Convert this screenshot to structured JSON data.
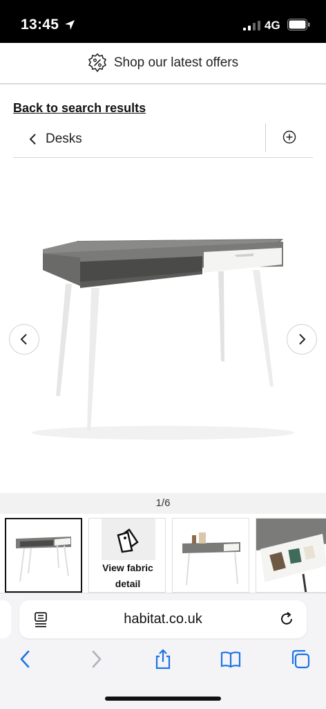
{
  "status_bar": {
    "time": "13:45",
    "network": "4G"
  },
  "offers": {
    "label": "Shop our latest offers"
  },
  "back_link": "Back to search results",
  "breadcrumb": {
    "label": "Desks"
  },
  "gallery": {
    "counter": "1/6"
  },
  "thumbnails": {
    "fabric_label": "View fabric detail"
  },
  "browser": {
    "url": "habitat.co.uk"
  },
  "colors": {
    "desk_top": "#7a7a78",
    "drawer": "#f4f4f2",
    "legs": "#ececec",
    "ios_blue": "#1a73e8"
  }
}
